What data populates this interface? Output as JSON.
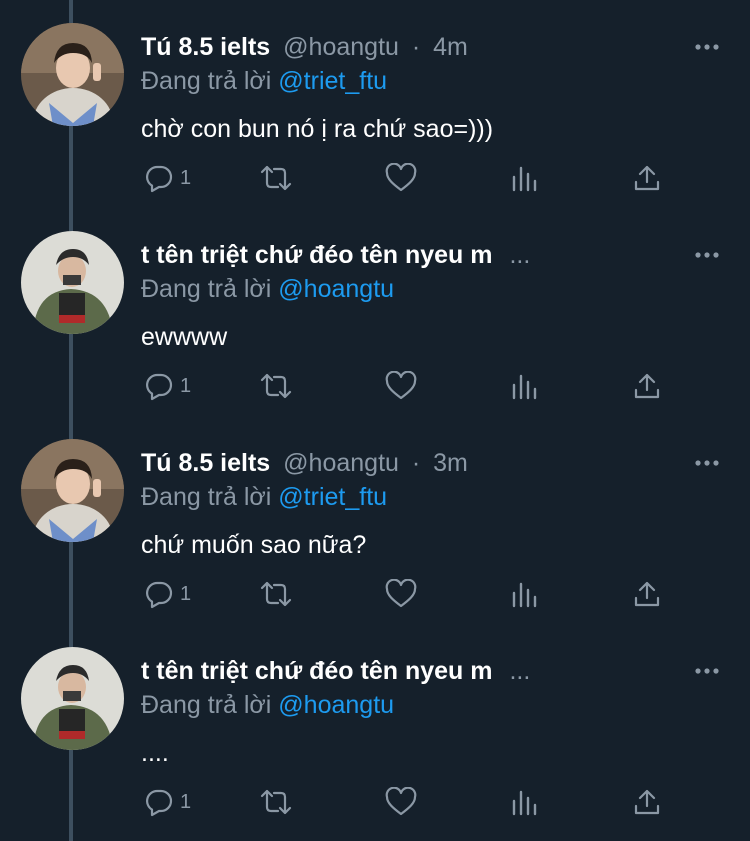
{
  "tweets": [
    {
      "name": "Tú 8.5 ielts",
      "handle": "@hoangtu",
      "dot": "·",
      "time": "4m",
      "truncated": "",
      "reply_prefix": "Đang trả lời",
      "reply_to": "@triet_ftu",
      "text": "chờ con bun nó ị ra chứ sao=)))",
      "reply_count": "1",
      "avatar": "user-a"
    },
    {
      "name": "t tên triệt chứ đéo tên nyeu m",
      "handle": "",
      "dot": "",
      "time": "",
      "truncated": "...",
      "reply_prefix": "Đang trả lời",
      "reply_to": "@hoangtu",
      "text": "ewwww",
      "reply_count": "1",
      "avatar": "user-b"
    },
    {
      "name": "Tú 8.5 ielts",
      "handle": "@hoangtu",
      "dot": "·",
      "time": "3m",
      "truncated": "",
      "reply_prefix": "Đang trả lời",
      "reply_to": "@triet_ftu",
      "text": "chứ muốn sao nữa?",
      "reply_count": "1",
      "avatar": "user-a"
    },
    {
      "name": "t tên triệt chứ đéo tên nyeu m",
      "handle": "",
      "dot": "",
      "time": "",
      "truncated": "...",
      "reply_prefix": "Đang trả lời",
      "reply_to": "@hoangtu",
      "text": "....",
      "reply_count": "1",
      "avatar": "user-b"
    }
  ],
  "icons": {
    "reply": "reply-icon",
    "retweet": "retweet-icon",
    "like": "heart-icon",
    "analytics": "analytics-icon",
    "share": "share-icon",
    "more": "more-icon"
  },
  "colors": {
    "background": "#15202b",
    "secondary_text": "#8b98a5",
    "accent": "#1d9bf0",
    "thread_line": "#3d4f5f"
  }
}
